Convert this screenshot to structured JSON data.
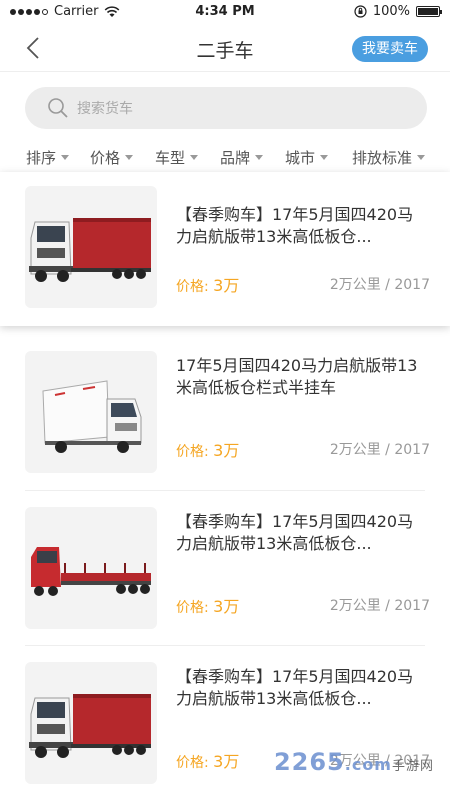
{
  "status": {
    "carrier": "Carrier",
    "time": "4:34 PM",
    "battery": "100%"
  },
  "nav": {
    "title": "二手车",
    "sell": "我要卖车"
  },
  "search": {
    "placeholder": "搜索货车"
  },
  "filters": [
    "排序",
    "价格",
    "车型",
    "品牌",
    "城市",
    "排放标准"
  ],
  "listings": [
    {
      "title": "【春季购车】17年5月国四420马力启航版带13米高低板仓...",
      "price_label": "价格:",
      "price": "3万",
      "mileage": "2万公里",
      "year": "2017",
      "truck": "red-box"
    },
    {
      "title": "17年5月国四420马力启航版带13米高低板仓栏式半挂车",
      "price_label": "价格:",
      "price": "3万",
      "mileage": "2万公里",
      "year": "2017",
      "truck": "white-van"
    },
    {
      "title": "【春季购车】17年5月国四420马力启航版带13米高低板仓...",
      "price_label": "价格:",
      "price": "3万",
      "mileage": "2万公里",
      "year": "2017",
      "truck": "red-flatbed"
    },
    {
      "title": "【春季购车】17年5月国四420马力启航版带13米高低板仓...",
      "price_label": "价格:",
      "price": "3万",
      "mileage": "2万公里",
      "year": "2017",
      "truck": "red-box"
    }
  ],
  "watermark": {
    "brand": "2265",
    "domain": ".com",
    "sub": "手游网"
  },
  "colors": {
    "accent": "#4a9ee0",
    "price": "#f5a623"
  }
}
